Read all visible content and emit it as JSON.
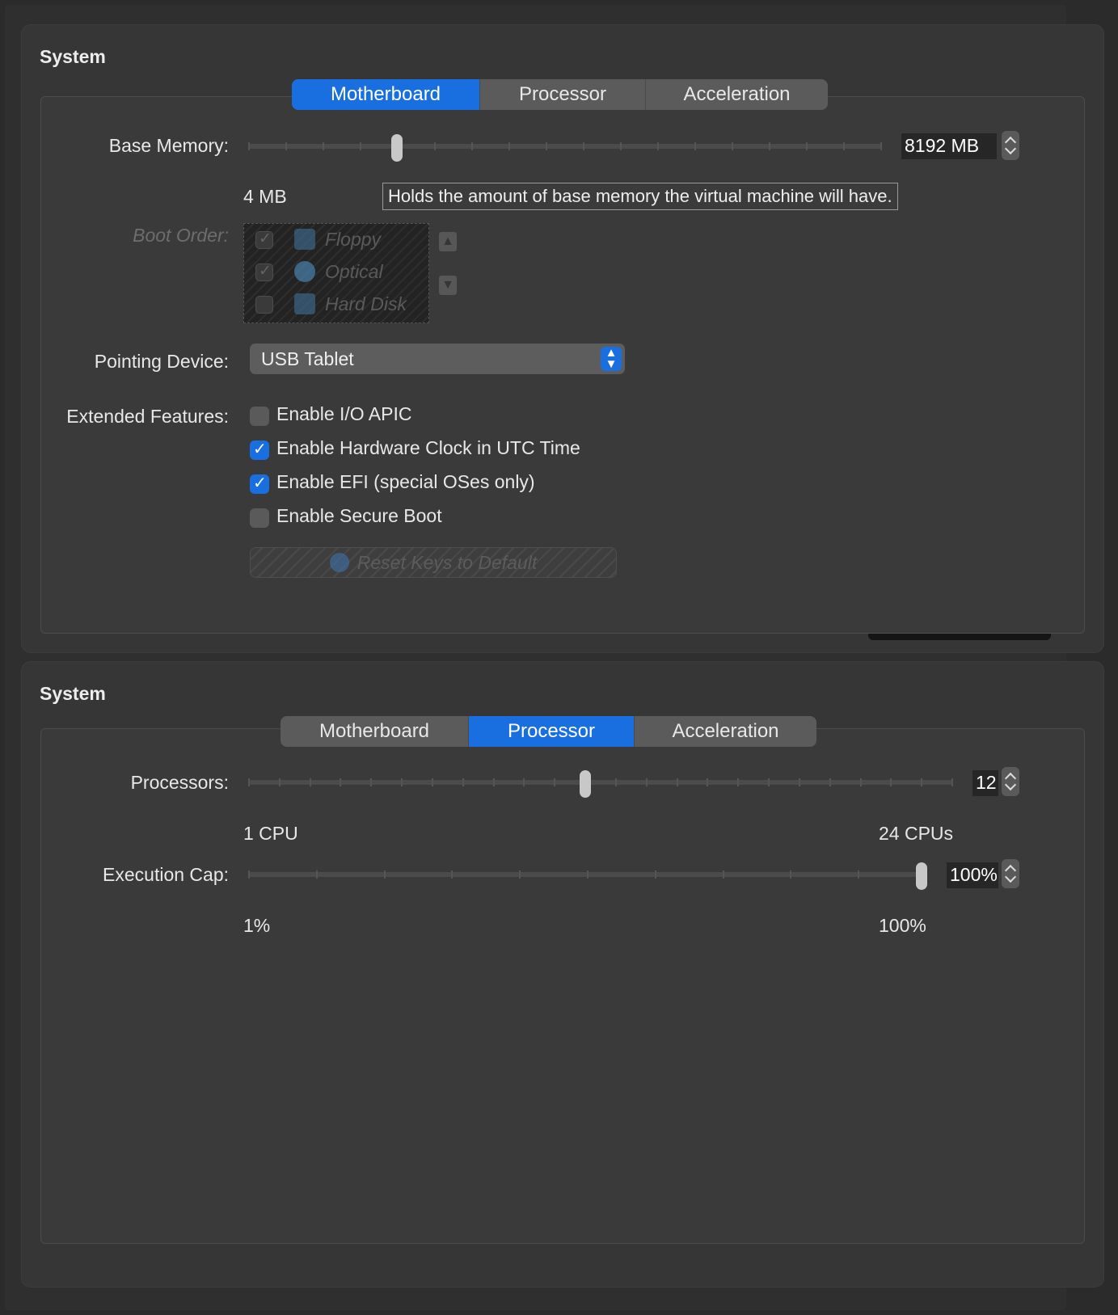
{
  "panel1": {
    "title": "System",
    "tabs": [
      "Motherboard",
      "Processor",
      "Acceleration"
    ],
    "active_tab": "Motherboard",
    "base_memory": {
      "label": "Base Memory:",
      "value": "8192 MB",
      "min_label": "4 MB",
      "level_fraction": 0.23,
      "tooltip": "Holds the amount of base memory the virtual machine will have."
    },
    "boot_order": {
      "label": "Boot Order:",
      "items": [
        {
          "label": "Floppy",
          "checked": true,
          "icon": "floppy-icon"
        },
        {
          "label": "Optical",
          "checked": true,
          "icon": "optical-disc-icon"
        },
        {
          "label": "Hard Disk",
          "checked": false,
          "icon": "hard-disk-icon"
        }
      ]
    },
    "pointing_device": {
      "label": "Pointing Device:",
      "value": "USB Tablet"
    },
    "extended_features": {
      "label": "Extended Features:",
      "options": [
        {
          "label": "Enable I/O APIC",
          "checked": false
        },
        {
          "label": "Enable Hardware Clock in UTC Time",
          "checked": true
        },
        {
          "label": "Enable EFI (special OSes only)",
          "checked": true
        },
        {
          "label": "Enable Secure Boot",
          "checked": false
        }
      ]
    },
    "reset_keys_label": "Reset Keys to Default"
  },
  "panel2": {
    "title": "System",
    "tabs": [
      "Motherboard",
      "Processor",
      "Acceleration"
    ],
    "active_tab": "Processor",
    "processors": {
      "label": "Processors:",
      "value": "12",
      "min_label": "1 CPU",
      "max_label": "24 CPUs",
      "level_fraction": 0.478
    },
    "execution_cap": {
      "label": "Execution Cap:",
      "value": "100%",
      "min_label": "1%",
      "max_label": "100%",
      "level_fraction": 1.0
    }
  },
  "colors": {
    "accent": "#1a6fe0",
    "panel_bg": "#363636",
    "window_bg": "#2b2b2b"
  }
}
